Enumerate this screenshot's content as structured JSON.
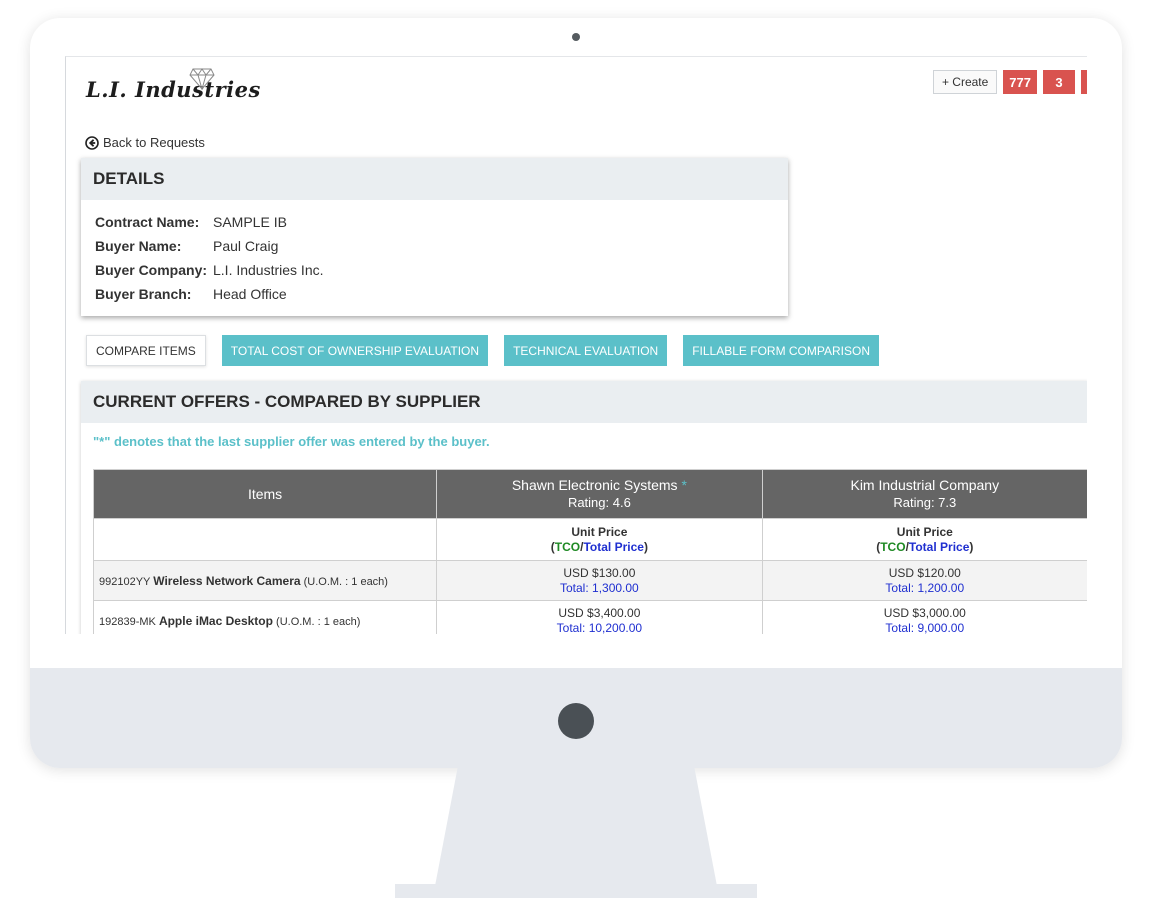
{
  "header": {
    "logo_text": "L.I. Industries",
    "create_label": "+ Create",
    "badges": [
      "777",
      "3"
    ]
  },
  "nav": {
    "back_label": "Back to Requests"
  },
  "details": {
    "title": "DETAILS",
    "rows": [
      {
        "label": "Contract Name:",
        "value": "SAMPLE IB"
      },
      {
        "label": "Buyer Name:",
        "value": "Paul Craig"
      },
      {
        "label": "Buyer Company:",
        "value": "L.I. Industries Inc."
      },
      {
        "label": "Buyer Branch:",
        "value": "Head Office"
      }
    ]
  },
  "tabs": [
    {
      "label": "COMPARE ITEMS",
      "active": true
    },
    {
      "label": "TOTAL COST OF OWNERSHIP EVALUATION",
      "active": false
    },
    {
      "label": "TECHNICAL EVALUATION",
      "active": false
    },
    {
      "label": "FILLABLE FORM COMPARISON",
      "active": false
    }
  ],
  "offers": {
    "title": "CURRENT OFFERS - COMPARED BY SUPPLIER",
    "note": "\"*\" denotes that the last supplier offer was entered by the buyer.",
    "items_header": "Items",
    "unit_price_label": "Unit Price",
    "tco_label": "TCO",
    "total_price_label": "Total Price",
    "suppliers": [
      {
        "name": "Shawn Electronic Systems",
        "star": "*",
        "rating": "Rating: 4.6"
      },
      {
        "name": "Kim Industrial Company",
        "star": "",
        "rating": "Rating: 7.3"
      }
    ],
    "rows": [
      {
        "code": "992102YY",
        "name": "Wireless Network Camera",
        "uom": "(U.O.M. : 1 each)",
        "prices": [
          {
            "unit": "USD $130.00",
            "total": "Total: 1,300.00"
          },
          {
            "unit": "USD $120.00",
            "total": "Total: 1,200.00"
          }
        ]
      },
      {
        "code": "192839-MK",
        "name": "Apple iMac Desktop",
        "uom": "(U.O.M. : 1 each)",
        "prices": [
          {
            "unit": "USD $3,400.00",
            "total": "Total: 10,200.00"
          },
          {
            "unit": "USD $3,000.00",
            "total": "Total: 9,000.00"
          }
        ]
      }
    ]
  },
  "colors": {
    "accent_teal": "#5bc0c9",
    "badge_red": "#d9534f",
    "tco_green": "#1f8a24",
    "total_blue": "#1f2fd0",
    "table_header": "#656565"
  }
}
